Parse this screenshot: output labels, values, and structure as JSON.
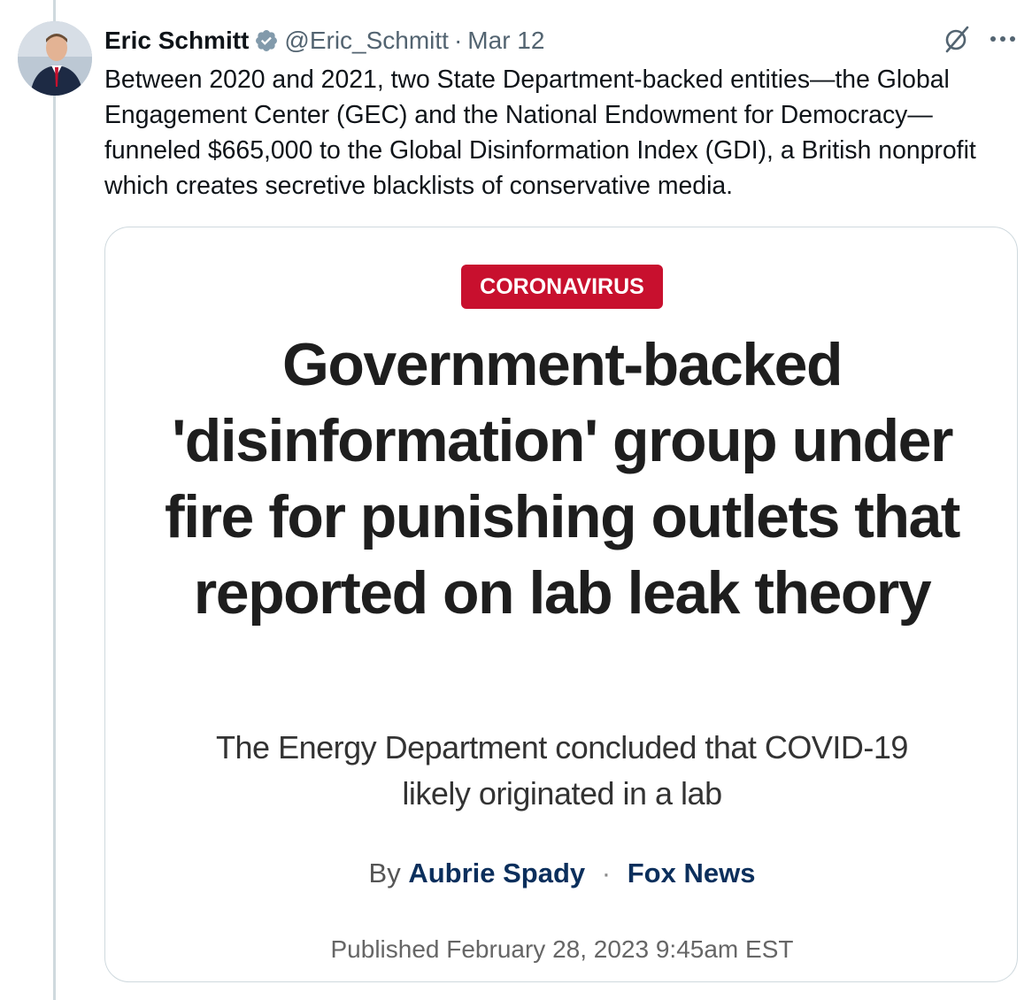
{
  "tweet": {
    "display_name": "Eric Schmitt",
    "handle": "@Eric_Schmitt",
    "separator": "·",
    "date": "Mar 12",
    "text": "Between 2020 and 2021, two State Department-backed entities—the Global Engagement Center (GEC) and the National Endowment for Democracy—funneled $665,000 to the Global Disinformation Index (GDI), a British nonprofit which creates secretive blacklists of conservative media."
  },
  "card": {
    "badge": "CORONAVIRUS",
    "headline": "Government-backed 'disinformation' group under fire for punishing outlets that reported on lab leak theory",
    "subhead": "The Energy Department concluded that COVID-19 likely originated in a lab",
    "by_label": "By",
    "author": "Aubrie Spady",
    "byline_separator": "·",
    "outlet": "Fox News",
    "published": "Published February 28, 2023 9:45am EST"
  },
  "colors": {
    "badge_bg": "#c8102e",
    "verified": "#829aab",
    "byline_link": "#0b2f5c",
    "secondary_text": "#536471"
  },
  "icons": {
    "verified": "verified-badge-icon",
    "grok": "grok-icon",
    "more": "more-icon"
  }
}
